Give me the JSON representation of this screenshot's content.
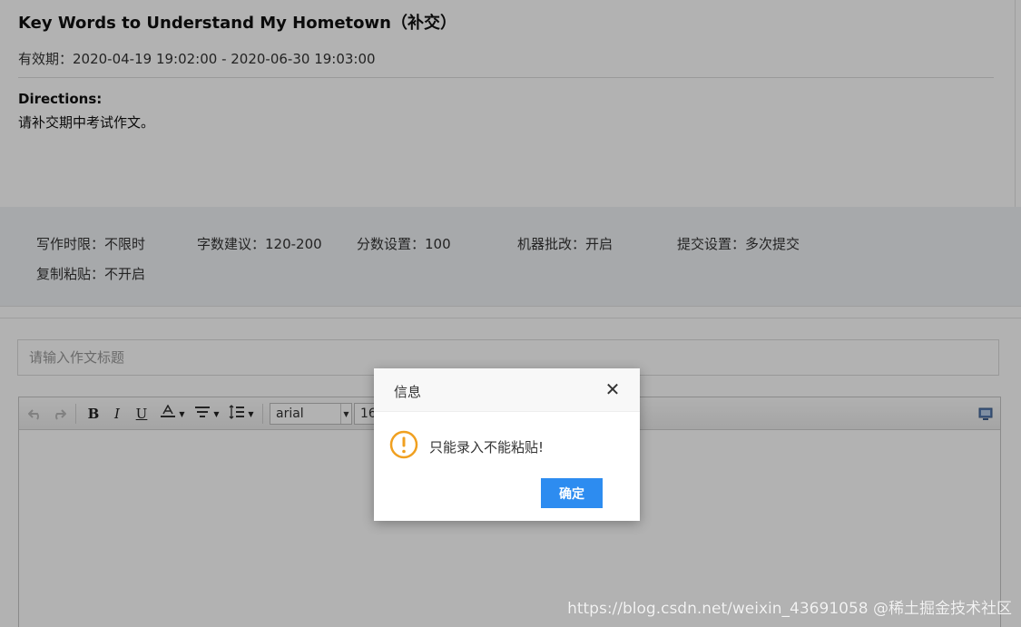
{
  "assignment": {
    "title": "Key Words to Understand My Hometown（补交）",
    "validity": "有效期：2020-04-19 19:02:00 - 2020-06-30 19:03:00",
    "directions_label": "Directions:",
    "directions_text": "请补交期中考试作文。"
  },
  "settings": {
    "time_limit": "写作时限：不限时",
    "word_count": "字数建议：120-200",
    "score": "分数设置：100",
    "machine_grading": "机器批改：开启",
    "submit": "提交设置：多次提交",
    "copy_paste": "复制粘贴：不开启"
  },
  "composition": {
    "title_placeholder": "请输入作文标题"
  },
  "editor": {
    "bold": "B",
    "italic": "I",
    "underline": "U",
    "font_family": "arial",
    "font_size": "16"
  },
  "dialog": {
    "title": "信息",
    "message": "只能录入不能粘贴!",
    "confirm": "确定",
    "close_symbol": "✕"
  },
  "watermark": {
    "text": "@稀土掘金技术社区",
    "url": "https://blog.csdn.net/weixin_43691058"
  },
  "colors": {
    "primary_button": "#2d8cf0",
    "warning_icon": "#f0a020"
  }
}
